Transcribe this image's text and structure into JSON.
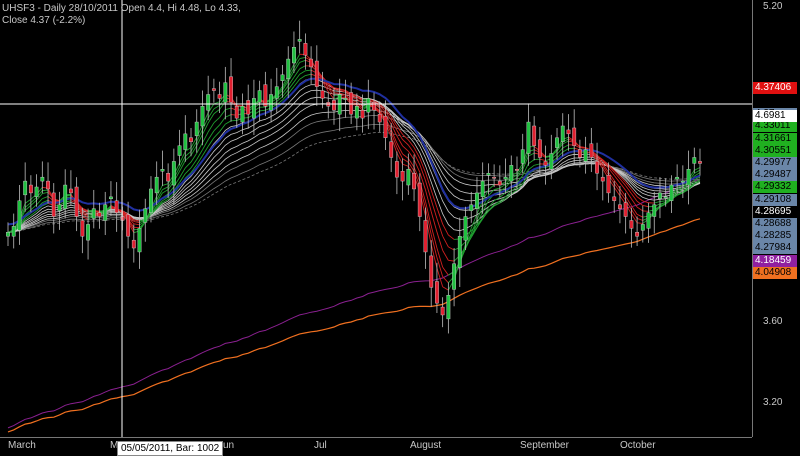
{
  "header": {
    "line1": "UHSF3 - Daily 28/10/2011 Open 4.4, Hi 4.48, Lo 4.33,",
    "line2": "Close 4.37 (-2.2%)"
  },
  "cursor": {
    "label": "05/05/2011, Bar: 1002",
    "price_label": "4.6981"
  },
  "chart_data": {
    "type": "line",
    "title": "UHSF3 - Daily 28/10/2011 Open 4.4, Hi 4.48, Lo 4.33, Close 4.37 (-2.2%)",
    "xlabel": "",
    "ylabel": "",
    "x_tick_labels": [
      "March",
      "May",
      "Jun",
      "Jul",
      "August",
      "September",
      "October"
    ],
    "y_tick_labels": [
      "5.20",
      "3.60",
      "3.20"
    ],
    "ylim": [
      2.98,
      5.2
    ],
    "grid": false,
    "close_series": [
      4.02,
      4.05,
      4.18,
      4.28,
      4.22,
      4.25,
      4.3,
      4.24,
      4.1,
      4.16,
      4.26,
      4.22,
      4.1,
      4.0,
      4.06,
      4.14,
      4.1,
      4.16,
      4.2,
      4.12,
      4.08,
      4.0,
      3.94,
      4.04,
      4.14,
      4.24,
      4.3,
      4.34,
      4.28,
      4.38,
      4.46,
      4.52,
      4.48,
      4.58,
      4.66,
      4.72,
      4.74,
      4.7,
      4.78,
      4.68,
      4.6,
      4.66,
      4.62,
      4.7,
      4.74,
      4.66,
      4.72,
      4.76,
      4.82,
      4.9,
      4.96,
      5.0,
      4.92,
      4.86,
      4.76,
      4.7,
      4.66,
      4.64,
      4.72,
      4.7,
      4.62,
      4.66,
      4.6,
      4.7,
      4.64,
      4.58,
      4.5,
      4.4,
      4.3,
      4.28,
      4.34,
      4.24,
      4.1,
      3.92,
      3.74,
      3.66,
      3.6,
      3.7,
      3.86,
      4.0,
      4.1,
      4.16,
      4.22,
      4.28,
      4.32,
      4.3,
      4.26,
      4.3,
      4.36,
      4.34,
      4.44,
      4.58,
      4.46,
      4.4,
      4.36,
      4.42,
      4.5,
      4.56,
      4.52,
      4.46,
      4.4,
      4.44,
      4.4,
      4.32,
      4.28,
      4.22,
      4.18,
      4.14,
      4.1,
      4.04,
      4.0,
      4.06,
      4.12,
      4.16,
      4.22,
      4.2,
      4.26,
      4.3,
      4.28,
      4.34,
      4.4,
      4.37
    ],
    "series_last_values": [
      {
        "value": 4.37406,
        "color": "#e01010"
      },
      {
        "value": 4.37,
        "color": "#606060"
      },
      {
        "value": 4.33011,
        "color": "#20b020"
      },
      {
        "value": 4.31661,
        "color": "#20b020"
      },
      {
        "value": 4.30551,
        "color": "#20b020"
      },
      {
        "value": 4.29977,
        "color": "#6a86a8"
      },
      {
        "value": 4.29487,
        "color": "#6a86a8"
      },
      {
        "value": 4.29332,
        "color": "#20b020"
      },
      {
        "value": 4.29108,
        "color": "#6a86a8"
      },
      {
        "value": 4.28695,
        "color": "#000000"
      },
      {
        "value": 4.28688,
        "color": "#6a86a8"
      },
      {
        "value": 4.28285,
        "color": "#6a86a8"
      },
      {
        "value": 4.27984,
        "color": "#6a86a8"
      },
      {
        "value": 4.18459,
        "color": "#9020a0"
      },
      {
        "value": 4.04908,
        "color": "#f07020"
      }
    ]
  }
}
